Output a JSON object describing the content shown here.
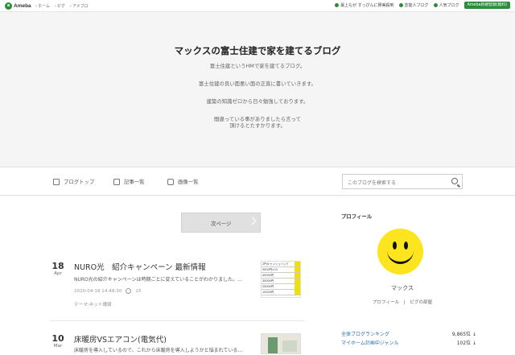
{
  "topbar": {
    "logo_mark": "a",
    "logo": "Ameba",
    "crumbs": [
      "ホーム",
      "ピグ",
      "アメブロ"
    ],
    "right": [
      "最上もが すっぴんに賛美殺到",
      "芸能人ブログ",
      "人気ブログ"
    ],
    "register": "Ameba新規登録(無料)"
  },
  "header": {
    "title": "マックスの富士住建で家を建てるブログ",
    "desc": [
      "富士住建というHMで家を建てるブログ。",
      "富士住建の良い面悪い面の正直に書いていきます。",
      "建築の知識ゼロから日々勉強しております。",
      "間違っている事がありましたら言って",
      "頂けるとたすかります。"
    ]
  },
  "nav": {
    "items": [
      "ブログトップ",
      "記事一覧",
      "画像一覧"
    ],
    "search_placeholder": "このブログを検索する"
  },
  "main": {
    "next_button": "次ページ",
    "posts": [
      {
        "day": "18",
        "month": "Apr",
        "title": "NURO光　紹介キャンペーン 最新情報",
        "excerpt": "NURO光の紹介キャンペーンは時期ごとに変えていることがわかりました。…",
        "datetime": "2020-04-18 14:48:30",
        "comments": "15",
        "theme": "テーマ:ネット環境",
        "thumb_rows": [
          "2円キャッシュバック",
          "5000円×12",
          "45000円",
          "30000円",
          "20000円",
          "10000円"
        ]
      },
      {
        "day": "10",
        "month": "Mar",
        "title": "床暖房VSエアコン(電気代)",
        "excerpt": "床暖房を導入しているので、これから床暖房を導入しようかと悩まれている…"
      }
    ]
  },
  "sidebar": {
    "heading": "プロフィール",
    "name": "マックス",
    "links": "プロフィール　|　ピグの部屋",
    "rankings": [
      {
        "label": "全体ブログランキング",
        "value": "9,865位 ↓"
      },
      {
        "label": "マイホーム計画中ジャンル",
        "value": "102位 ↓"
      }
    ]
  },
  "colors": {
    "brand": "#2d8c3c",
    "smiley": "#fce51e",
    "link": "#2a6fb0"
  }
}
